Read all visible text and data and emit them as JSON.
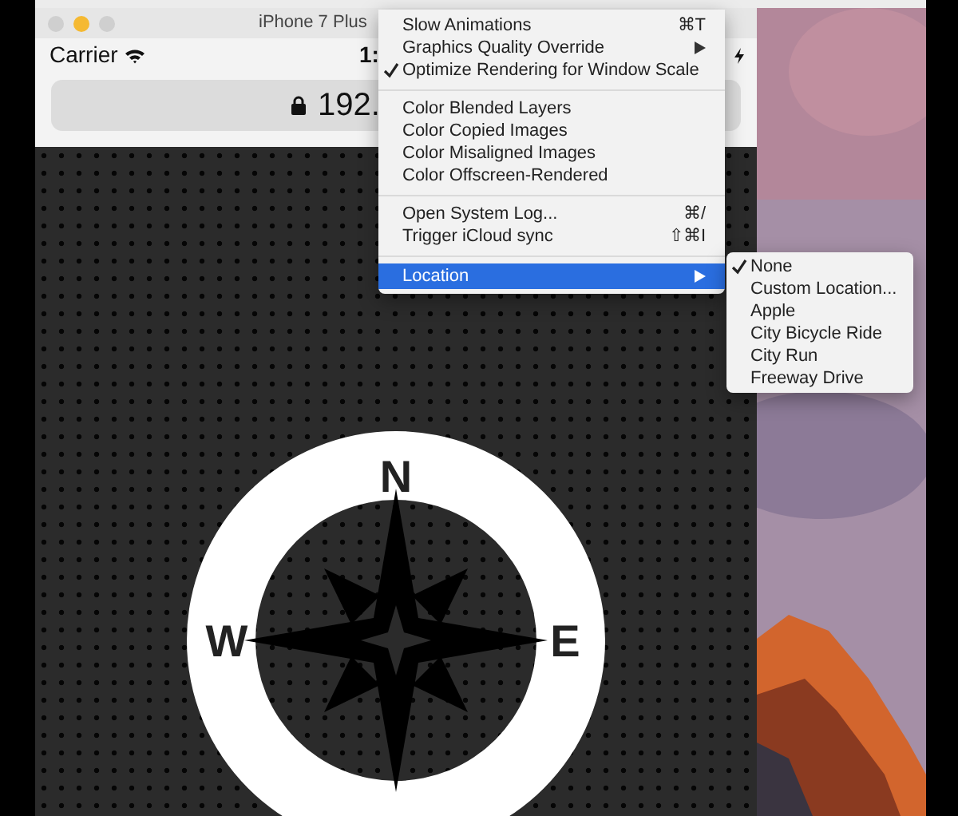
{
  "window": {
    "title": "iPhone 7 Plus"
  },
  "status_bar": {
    "carrier": "Carrier",
    "time": "1:"
  },
  "address_bar": {
    "text": "192."
  },
  "compass": {
    "labels": [
      "N",
      "W",
      "E"
    ]
  },
  "debug_menu": {
    "groups": [
      [
        {
          "label": "Slow Animations",
          "shortcut": "⌘T",
          "checked": false,
          "submenu": false,
          "selected": false
        },
        {
          "label": "Graphics Quality Override",
          "checked": false,
          "submenu": true,
          "selected": false
        },
        {
          "label": "Optimize Rendering for Window Scale",
          "checked": true,
          "submenu": false,
          "selected": false
        }
      ],
      [
        {
          "label": "Color Blended Layers",
          "checked": false,
          "submenu": false,
          "selected": false
        },
        {
          "label": "Color Copied Images",
          "checked": false,
          "submenu": false,
          "selected": false
        },
        {
          "label": "Color Misaligned Images",
          "checked": false,
          "submenu": false,
          "selected": false
        },
        {
          "label": "Color Offscreen-Rendered",
          "checked": false,
          "submenu": false,
          "selected": false
        }
      ],
      [
        {
          "label": "Open System Log...",
          "shortcut": "⌘/",
          "checked": false,
          "submenu": false,
          "selected": false
        },
        {
          "label": "Trigger iCloud sync",
          "shortcut": "⇧⌘I",
          "checked": false,
          "submenu": false,
          "selected": false
        }
      ],
      [
        {
          "label": "Location",
          "checked": false,
          "submenu": true,
          "selected": true
        }
      ]
    ]
  },
  "location_menu": {
    "items": [
      {
        "label": "None",
        "checked": true
      },
      {
        "label": "Custom Location...",
        "checked": false
      },
      {
        "label": "Apple",
        "checked": false
      },
      {
        "label": "City Bicycle Ride",
        "checked": false
      },
      {
        "label": "City Run",
        "checked": false
      },
      {
        "label": "Freeway Drive",
        "checked": false
      }
    ]
  }
}
